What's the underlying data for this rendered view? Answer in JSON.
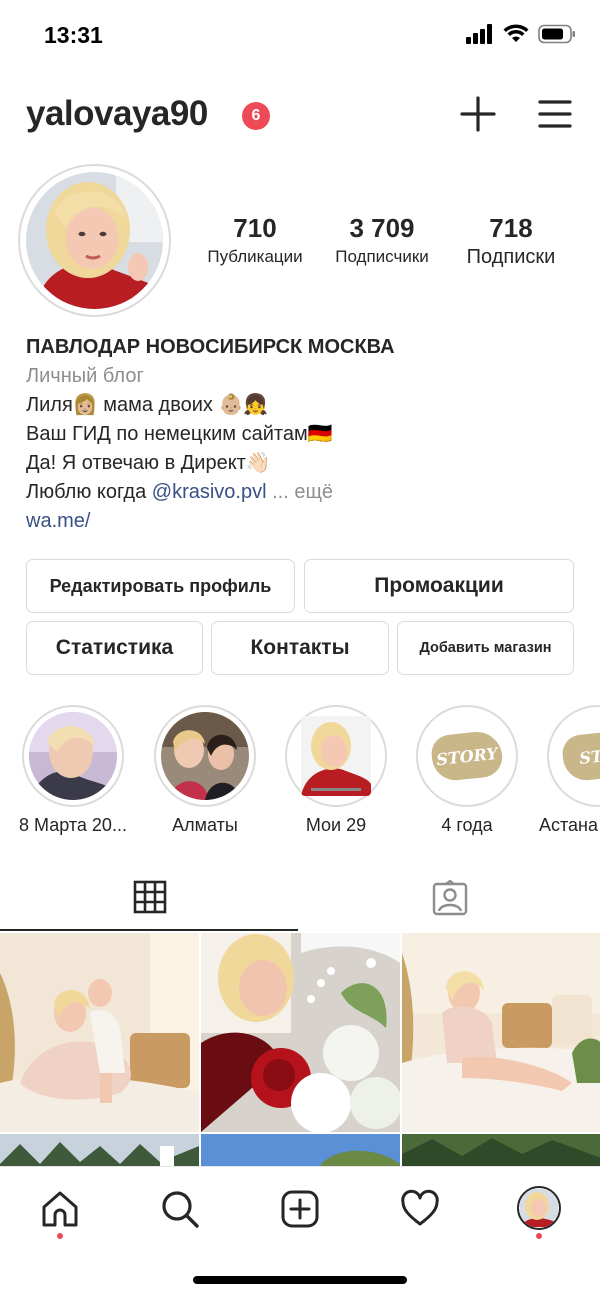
{
  "status_bar": {
    "time": "13:31"
  },
  "header": {
    "username": "yalovaya90",
    "notification_count": "6"
  },
  "stats": [
    {
      "value": "710",
      "label": "Публикации"
    },
    {
      "value": "3 709",
      "label": "Подписчики"
    },
    {
      "value": "718",
      "label": "Подписки"
    }
  ],
  "bio": {
    "name": "ПАВЛОДАР НОВОСИБИРСК МОСКВА",
    "category": "Личный блог",
    "line1": "Лиля👩🏼 мама двоих 👶🏼👧",
    "line2": "Ваш ГИД по немецким сайтам🇩🇪",
    "line3": "Да! Я отвечаю в Директ👋🏻",
    "line4_prefix": "Люблю когда ",
    "line4_mention": "@krasivo.pvl",
    "line4_more": " ... ещё",
    "link": "wa.me/"
  },
  "buttons": {
    "edit_profile": "Редактировать профиль",
    "promotions": "Промоакции",
    "statistics": "Статистика",
    "contacts": "Контакты",
    "add_shop": "Добавить магазин"
  },
  "highlights": [
    {
      "label": "8 Марта 20..."
    },
    {
      "label": "Алматы"
    },
    {
      "label": "Мои 29"
    },
    {
      "label": "4 года",
      "badge": "STORY"
    },
    {
      "label": "Астана",
      "badge": "STO"
    }
  ],
  "colors": {
    "accent_red": "#ed4956",
    "link_blue": "#385185",
    "border": "#dbdbdb",
    "muted": "#8e8e8e"
  }
}
